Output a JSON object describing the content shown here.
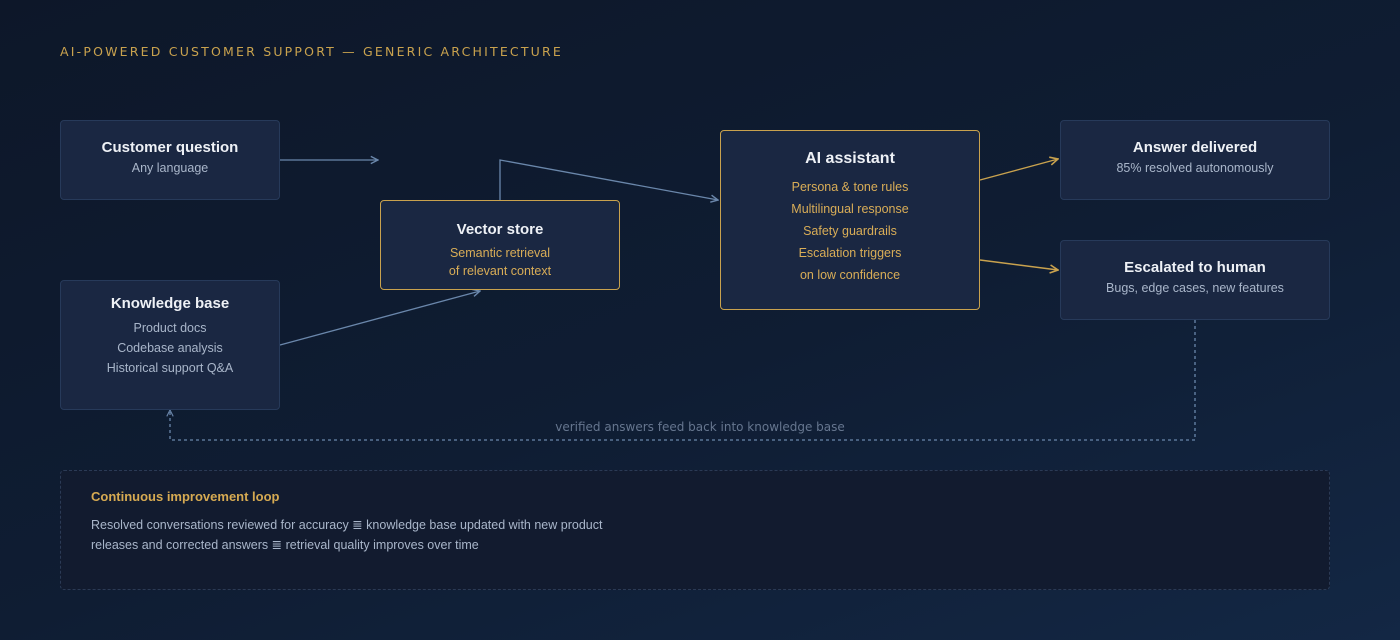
{
  "title": "AI-POWERED CUSTOMER SUPPORT — GENERIC ARCHITECTURE",
  "nodes": {
    "customer": {
      "title": "Customer question",
      "lines": [
        "Any language"
      ]
    },
    "knowledge": {
      "title": "Knowledge base",
      "lines": [
        "Product docs",
        "Codebase analysis",
        "Historical support Q&A"
      ]
    },
    "vector": {
      "title": "Vector store",
      "lines": [
        "Semantic retrieval",
        "of relevant context"
      ]
    },
    "assistant": {
      "title": "AI assistant",
      "lines": [
        "Persona & tone rules",
        "Multilingual response",
        "Safety guardrails",
        "Escalation triggers",
        "on low confidence"
      ]
    },
    "answer": {
      "title": "Answer delivered",
      "lines": [
        "85% resolved autonomously"
      ]
    },
    "escalated": {
      "title": "Escalated to human",
      "lines": [
        "Bugs, edge cases, new features"
      ]
    }
  },
  "feedback_label": "verified answers feed back into knowledge base",
  "improvement": {
    "heading": "Continuous improvement loop",
    "body": "Resolved conversations reviewed for accuracy ≣ knowledge base updated with new product releases and corrected answers ≣ retrieval quality improves over time"
  },
  "colors": {
    "gold": "#c9a24e",
    "connector": "#6a87ab",
    "box": "#1a2742",
    "border": "#273a5a"
  }
}
